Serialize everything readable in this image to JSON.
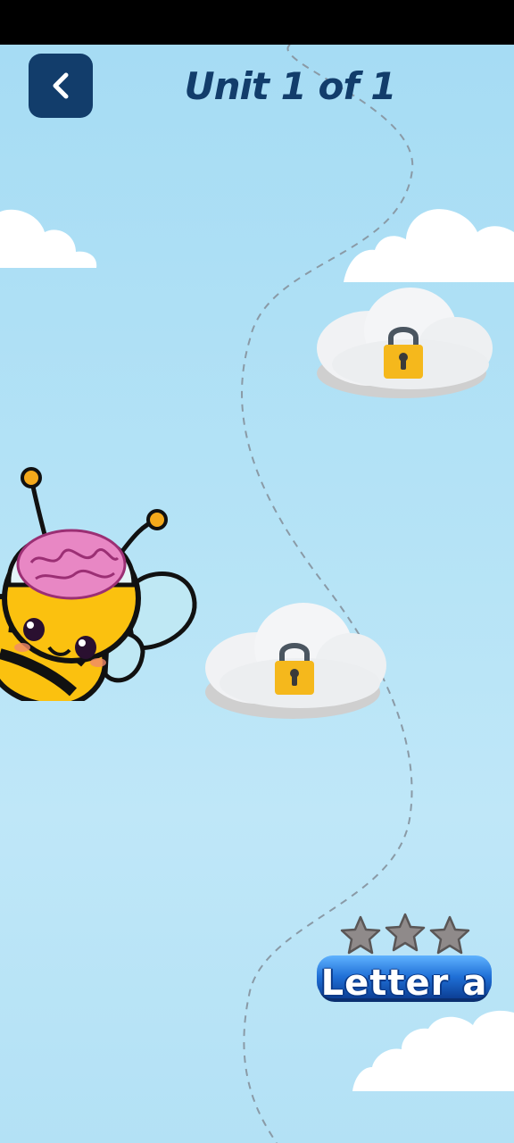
{
  "header": {
    "title": "Unit 1 of 1",
    "back_label": "Back"
  },
  "levels": [
    {
      "state": "locked",
      "icon": "padlock-icon"
    },
    {
      "state": "locked",
      "icon": "padlock-icon"
    },
    {
      "state": "unlocked",
      "label": "Letter a",
      "stars_earned": 0,
      "stars_total": 3
    }
  ],
  "mascot": {
    "icon": "bee-with-brain-icon"
  },
  "colors": {
    "header_accent": "#123d6b",
    "sky": "#b5e3f6",
    "lock": "#f5b81c",
    "level_button": "#1f6fd6"
  }
}
